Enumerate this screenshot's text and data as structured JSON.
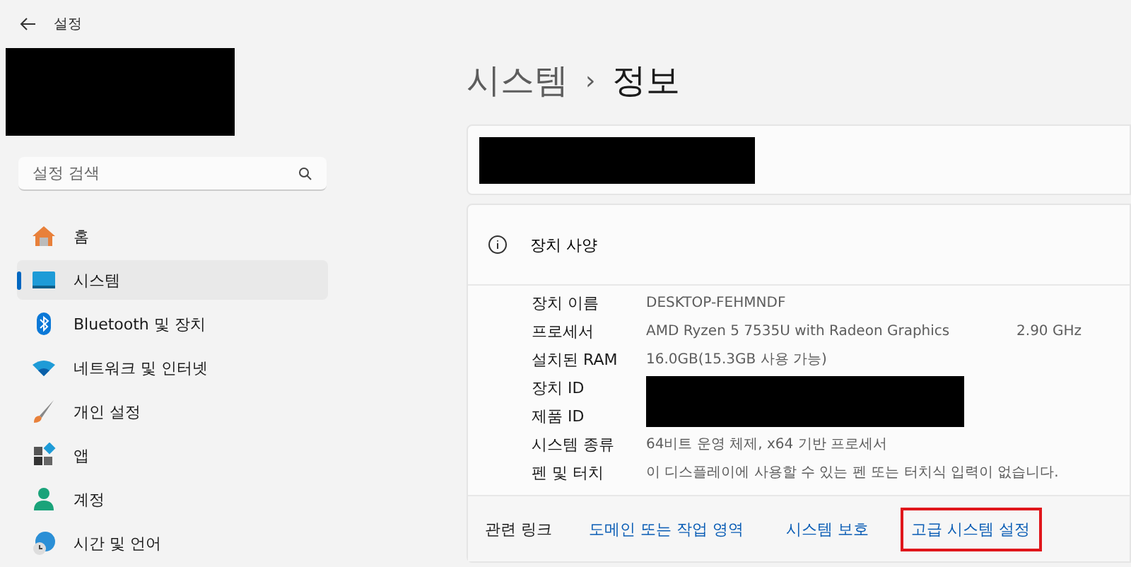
{
  "window": {
    "title": "설정"
  },
  "search": {
    "placeholder": "설정 검색"
  },
  "nav": [
    {
      "label": "홈",
      "kind": "home",
      "selected": false
    },
    {
      "label": "시스템",
      "kind": "system",
      "selected": true
    },
    {
      "label": "Bluetooth 및 장치",
      "kind": "bluetooth",
      "selected": false
    },
    {
      "label": "네트워크 및 인터넷",
      "kind": "network",
      "selected": false
    },
    {
      "label": "개인 설정",
      "kind": "brush",
      "selected": false
    },
    {
      "label": "앱",
      "kind": "apps",
      "selected": false
    },
    {
      "label": "계정",
      "kind": "account",
      "selected": false
    },
    {
      "label": "시간 및 언어",
      "kind": "time",
      "selected": false
    }
  ],
  "breadcrumb": {
    "parent": "시스템",
    "separator": "›",
    "current": "정보"
  },
  "specs": {
    "title": "장치 사양",
    "rows": [
      {
        "label": "장치 이름",
        "value": "DESKTOP-FEHMNDF"
      },
      {
        "label": "프로세서",
        "value": "AMD Ryzen 5 7535U with Radeon Graphics",
        "extra": "2.90 GHz"
      },
      {
        "label": "설치된 RAM",
        "value": "16.0GB(15.3GB 사용 가능)"
      },
      {
        "label": "장치 ID",
        "redacted": true
      },
      {
        "label": "제품 ID",
        "redacted": true
      },
      {
        "label": "시스템 종류",
        "value": "64비트 운영 체제, x64 기반 프로세서"
      },
      {
        "label": "펜 및 터치",
        "value": "이 디스플레이에 사용할 수 있는 펜 또는 터치식 입력이 없습니다."
      }
    ]
  },
  "related": {
    "title": "관련 링크",
    "links": [
      {
        "label": "도메인 또는 작업 영역",
        "highlighted": false
      },
      {
        "label": "시스템 보호",
        "highlighted": false
      },
      {
        "label": "고급 시스템 설정",
        "highlighted": true
      }
    ]
  }
}
